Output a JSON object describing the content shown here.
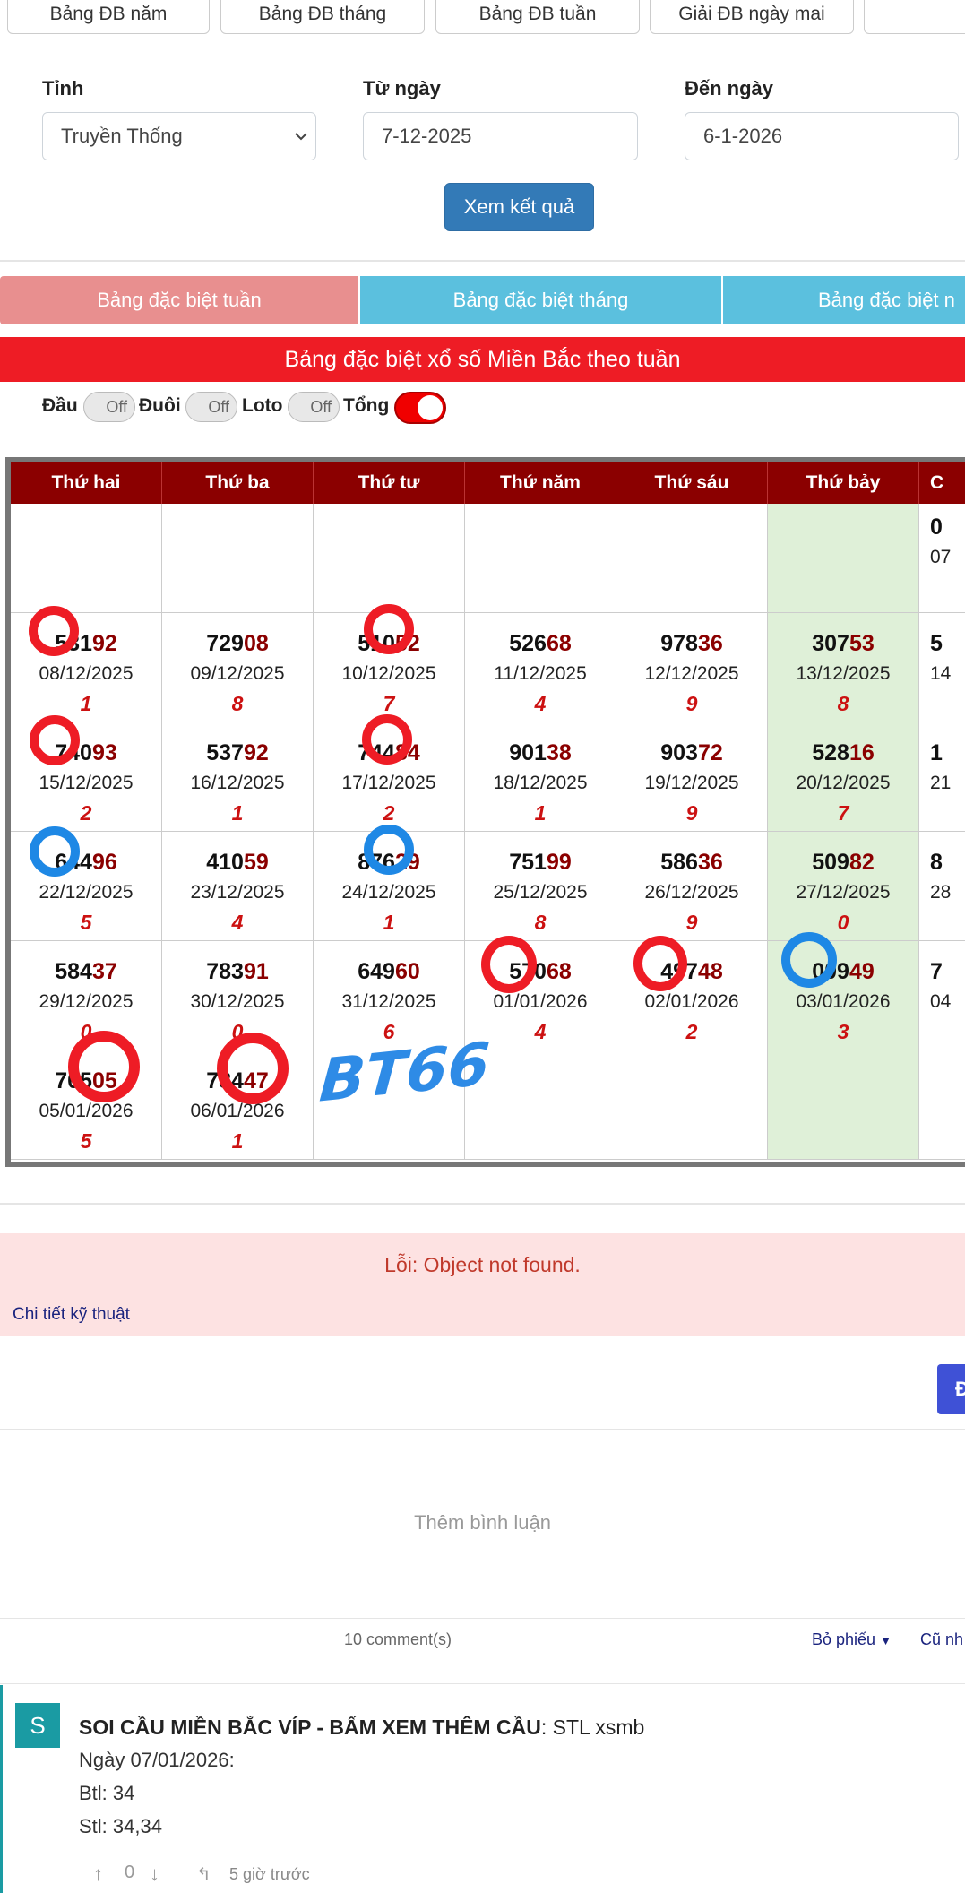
{
  "top_tabs": [
    "Bảng ĐB năm",
    "Bảng ĐB tháng",
    "Bảng ĐB tuần",
    "Giải ĐB ngày mai"
  ],
  "form": {
    "province_label": "Tỉnh",
    "province_value": "Truyền Thống",
    "from_label": "Từ ngày",
    "from_value": "7-12-2025",
    "to_label": "Đến ngày",
    "to_value": "6-1-2026",
    "submit_label": "Xem kết quả"
  },
  "sub_tabs": [
    "Bảng đặc biệt tuần",
    "Bảng đặc biệt tháng",
    "Bảng đặc biệt n"
  ],
  "banner_title": "Bảng đặc biệt xổ số Miền Bắc theo tuần",
  "toggles": [
    {
      "label": "Đầu",
      "state": "Off"
    },
    {
      "label": "Đuôi",
      "state": "Off"
    },
    {
      "label": "Loto",
      "state": "Off"
    },
    {
      "label": "Tổng",
      "state": ""
    }
  ],
  "table": {
    "headers": [
      "Thứ hai",
      "Thứ ba",
      "Thứ tư",
      "Thứ năm",
      "Thứ sáu",
      "Thứ bảy",
      "C"
    ],
    "row0_partial": {
      "num": "0",
      "date": "07"
    },
    "rows": [
      [
        {
          "head": "531",
          "tail": "92",
          "date": "08/12/2025",
          "sum": "1"
        },
        {
          "head": "729",
          "tail": "08",
          "date": "09/12/2025",
          "sum": "8"
        },
        {
          "head": "510",
          "tail": "52",
          "date": "10/12/2025",
          "sum": "7"
        },
        {
          "head": "526",
          "tail": "68",
          "date": "11/12/2025",
          "sum": "4"
        },
        {
          "head": "978",
          "tail": "36",
          "date": "12/12/2025",
          "sum": "9"
        },
        {
          "head": "307",
          "tail": "53",
          "date": "13/12/2025",
          "sum": "8"
        },
        {
          "head": "5",
          "tail": "",
          "date": "14",
          "sum": ""
        }
      ],
      [
        {
          "head": "740",
          "tail": "93",
          "date": "15/12/2025",
          "sum": "2"
        },
        {
          "head": "537",
          "tail": "92",
          "date": "16/12/2025",
          "sum": "1"
        },
        {
          "head": "744",
          "tail": "84",
          "date": "17/12/2025",
          "sum": "2"
        },
        {
          "head": "901",
          "tail": "38",
          "date": "18/12/2025",
          "sum": "1"
        },
        {
          "head": "903",
          "tail": "72",
          "date": "19/12/2025",
          "sum": "9"
        },
        {
          "head": "528",
          "tail": "16",
          "date": "20/12/2025",
          "sum": "7"
        },
        {
          "head": "1",
          "tail": "",
          "date": "21",
          "sum": ""
        }
      ],
      [
        {
          "head": "644",
          "tail": "96",
          "date": "22/12/2025",
          "sum": "5"
        },
        {
          "head": "410",
          "tail": "59",
          "date": "23/12/2025",
          "sum": "4"
        },
        {
          "head": "876",
          "tail": "29",
          "date": "24/12/2025",
          "sum": "1"
        },
        {
          "head": "751",
          "tail": "99",
          "date": "25/12/2025",
          "sum": "8"
        },
        {
          "head": "586",
          "tail": "36",
          "date": "26/12/2025",
          "sum": "9"
        },
        {
          "head": "509",
          "tail": "82",
          "date": "27/12/2025",
          "sum": "0"
        },
        {
          "head": "8",
          "tail": "",
          "date": "28",
          "sum": ""
        }
      ],
      [
        {
          "head": "584",
          "tail": "37",
          "date": "29/12/2025",
          "sum": "0"
        },
        {
          "head": "783",
          "tail": "91",
          "date": "30/12/2025",
          "sum": "0"
        },
        {
          "head": "649",
          "tail": "60",
          "date": "31/12/2025",
          "sum": "6"
        },
        {
          "head": "570",
          "tail": "68",
          "date": "01/01/2026",
          "sum": "4"
        },
        {
          "head": "497",
          "tail": "48",
          "date": "02/01/2026",
          "sum": "2"
        },
        {
          "head": "009",
          "tail": "49",
          "date": "03/01/2026",
          "sum": "3"
        },
        {
          "head": "7",
          "tail": "",
          "date": "04",
          "sum": ""
        }
      ],
      [
        {
          "head": "705",
          "tail": "05",
          "date": "05/01/2026",
          "sum": "5"
        },
        {
          "head": "784",
          "tail": "47",
          "date": "06/01/2026",
          "sum": "1"
        },
        {
          "head": "",
          "tail": "",
          "date": "",
          "sum": ""
        },
        {
          "head": "",
          "tail": "",
          "date": "",
          "sum": ""
        },
        {
          "head": "",
          "tail": "",
          "date": "",
          "sum": ""
        },
        {
          "head": "",
          "tail": "",
          "date": "",
          "sum": ""
        },
        {
          "head": "",
          "tail": "",
          "date": "",
          "sum": ""
        }
      ]
    ]
  },
  "watermark": "BT66",
  "error": {
    "message": "Lỗi: Object not found.",
    "details_link": "Chi tiết kỹ thuật"
  },
  "side_button_label": "Đ",
  "comments": {
    "add_placeholder": "Thêm bình luận",
    "count_label": "10 comment(s)",
    "vote_sort": "Bỏ phiếu",
    "old_sort": "Cũ nh",
    "item": {
      "avatar_letter": "S",
      "author": "SOI CẦU MIỀN BẮC VÍP - BẤM XEM THÊM CẦU",
      "author_suffix": ": STL xsmb",
      "lines": [
        "Ngày 07/01/2026:",
        "Btl: 34",
        "Stl: 34,34"
      ],
      "votes": "0",
      "time": "5 giờ trước"
    }
  },
  "colors": {
    "accent_red": "#ee1c25",
    "header_dark_red": "#8b0000",
    "button_blue": "#337ab7",
    "saturday_green": "#dff0d8",
    "teal": "#1a9ba3"
  }
}
